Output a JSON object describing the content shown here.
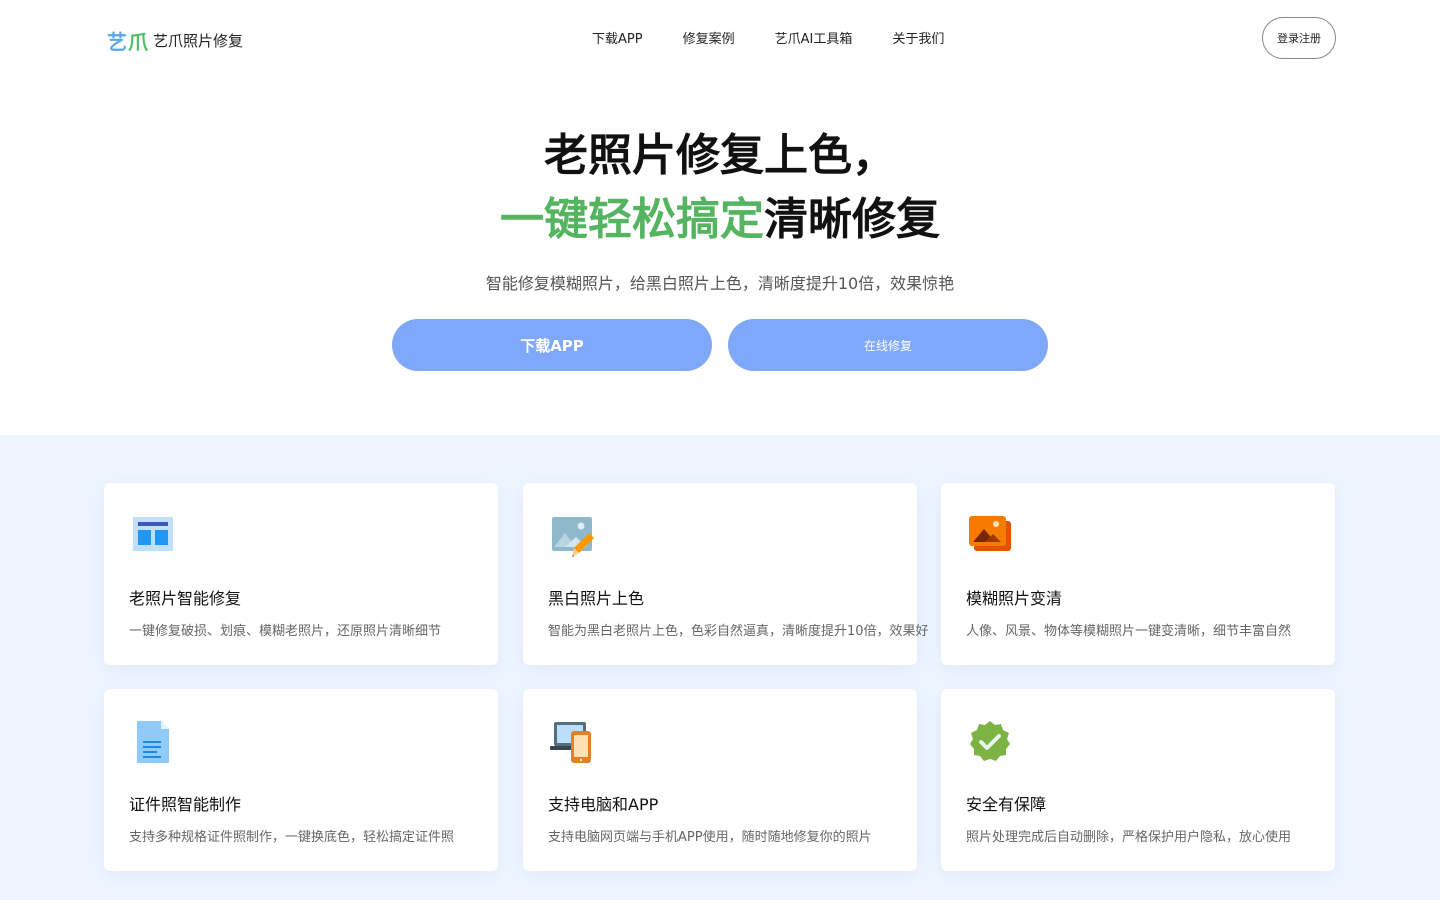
{
  "header": {
    "logo_mark_1": "艺",
    "logo_mark_2": "爪",
    "logo_text": "艺爪照片修复",
    "nav": [
      {
        "label": "下载APP"
      },
      {
        "label": "修复案例"
      },
      {
        "label": "艺爪AI工具箱"
      },
      {
        "label": "关于我们"
      }
    ],
    "login_label": "登录注册"
  },
  "hero": {
    "line1": "老照片修复上色，",
    "line2_green": "一键轻松搞定",
    "line2_rest": "清晰修复",
    "subtitle": "智能修复模糊照片，给黑白照片上色，清晰度提升10倍，效果惊艳",
    "cta_primary": "下载APP",
    "cta_secondary": "在线修复"
  },
  "features": [
    {
      "icon": "layout-icon",
      "title": "老照片智能修复",
      "desc": "一键修复破损、划痕、模糊老照片，还原照片清晰细节"
    },
    {
      "icon": "image-edit-icon",
      "title": "黑白照片上色",
      "desc": "智能为黑白老照片上色，色彩自然逼真，清晰度提升10倍，效果好"
    },
    {
      "icon": "photos-icon",
      "title": "模糊照片变清",
      "desc": "人像、风景、物体等模糊照片一键变清晰，细节丰富自然"
    },
    {
      "icon": "document-icon",
      "title": "证件照智能制作",
      "desc": "支持多种规格证件照制作，一键换底色，轻松搞定证件照"
    },
    {
      "icon": "devices-icon",
      "title": "支持电脑和APP",
      "desc": "支持电脑网页端与手机APP使用，随时随地修复你的照片"
    },
    {
      "icon": "verified-icon",
      "title": "安全有保障",
      "desc": "照片处理完成后自动删除，严格保护用户隐私，放心使用"
    }
  ],
  "colors": {
    "accent_green": "#55b45f",
    "cta_blue": "#7fa8fb",
    "feature_bg": "#eef5ff"
  }
}
